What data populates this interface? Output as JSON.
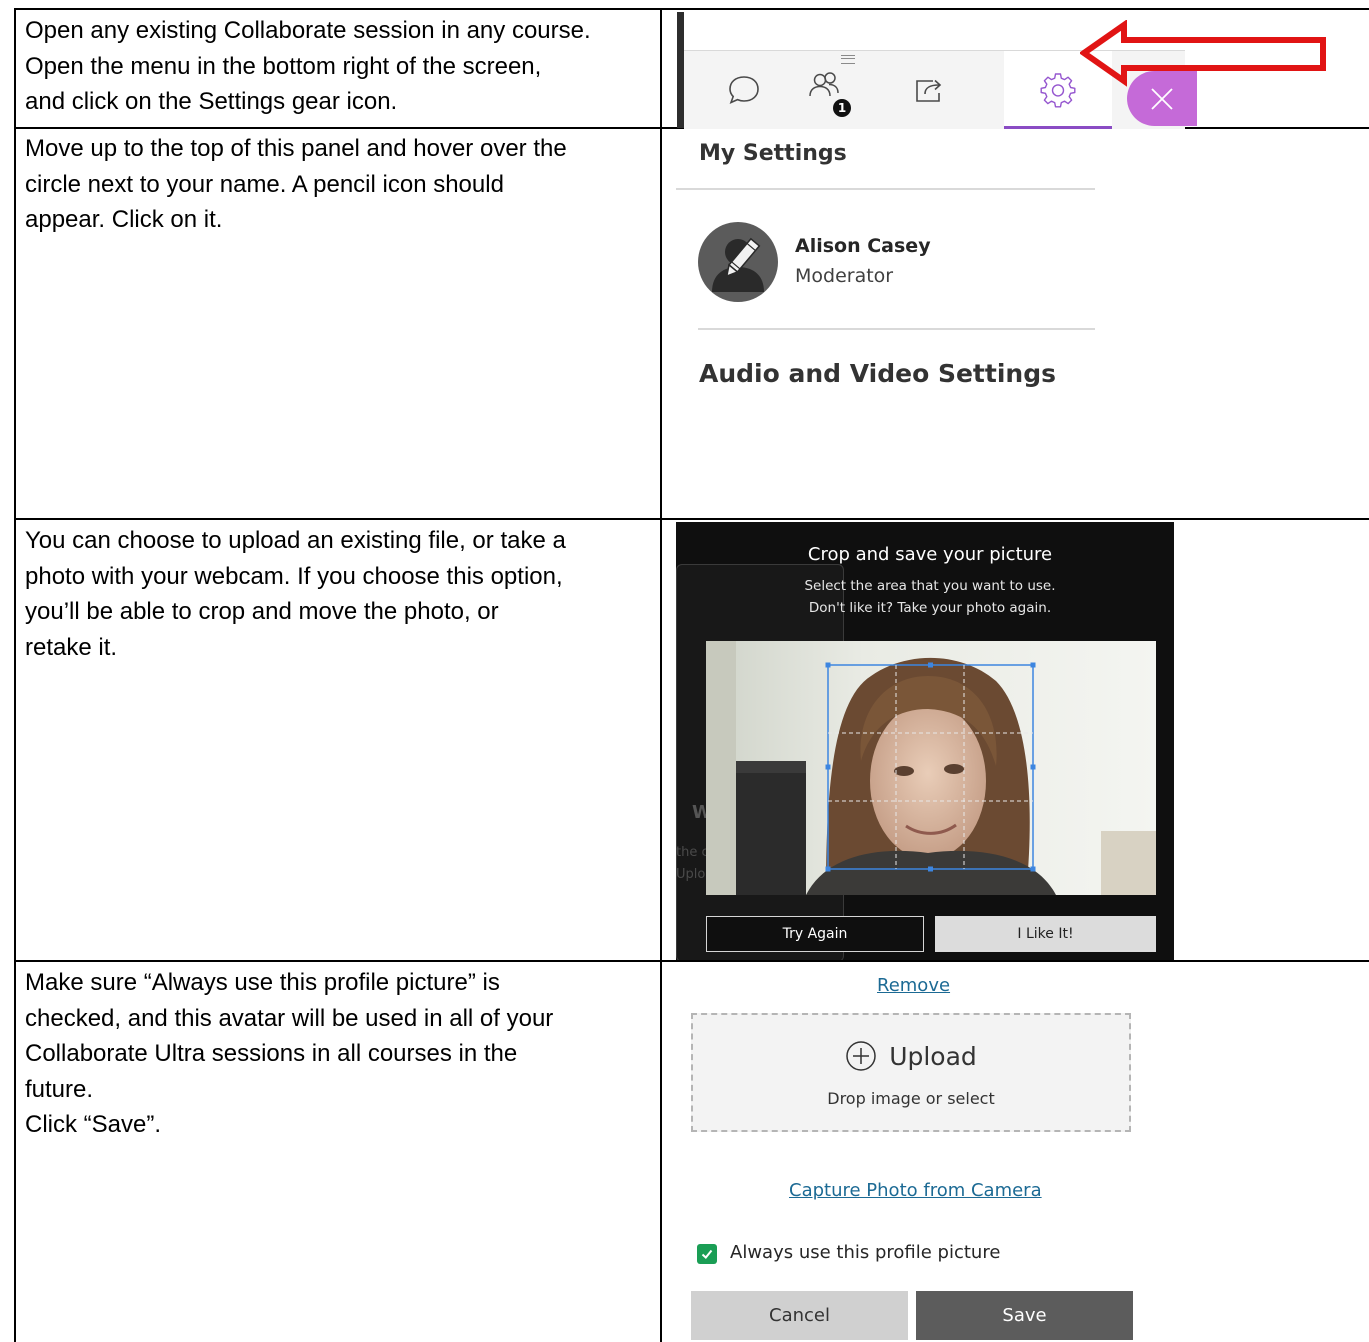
{
  "rows": [
    {
      "instruction_lines": [
        "Open any existing Collaborate session in any course.",
        "Open the menu in the bottom right of the screen,",
        "and click on the Settings gear icon."
      ]
    },
    {
      "instruction_lines": [
        "Move up to the top of this panel and hover over the",
        "circle next to your name. A pencil icon should",
        "appear. Click on it."
      ]
    },
    {
      "instruction_lines": [
        "You can choose to upload an existing file, or take a",
        "photo with your webcam. If you choose this option,",
        "you’ll be able to crop and move the photo, or",
        "retake it."
      ]
    },
    {
      "instruction_lines": [
        "Make sure “Always use this profile picture” is",
        "checked, and this avatar will be used in all of your",
        "Collaborate Ultra sessions in all courses in the",
        "future.",
        "Click “Save”."
      ]
    }
  ],
  "toolbar": {
    "attendee_count": "1",
    "icons": [
      "chat-icon",
      "attendees-icon",
      "share-content-icon",
      "gear-icon",
      "close-icon"
    ],
    "accent_color": "#8a4cc4",
    "close_color": "#c56ad8",
    "annotation_arrow_color": "#e11414"
  },
  "settings_panel": {
    "title": "My Settings",
    "user_name": "Alison Casey",
    "user_role": "Moderator",
    "section_title": "Audio and Video Settings"
  },
  "crop_dialog": {
    "title": "Crop and save your picture",
    "subtitle_1": "Select the area that you want to use.",
    "subtitle_2": "Don't like it? Take your photo again.",
    "background_letter": "W",
    "background_text_1": "the c",
    "background_text_2": "Uplo",
    "try_again_label": "Try Again",
    "like_label": "I Like It!"
  },
  "upload_panel": {
    "remove_label": "Remove",
    "upload_label": "Upload",
    "drop_hint": "Drop image or select",
    "capture_label": "Capture Photo from Camera",
    "checkbox_label": "Always use this profile picture",
    "checkbox_checked": true,
    "cancel_label": "Cancel",
    "save_label": "Save"
  }
}
